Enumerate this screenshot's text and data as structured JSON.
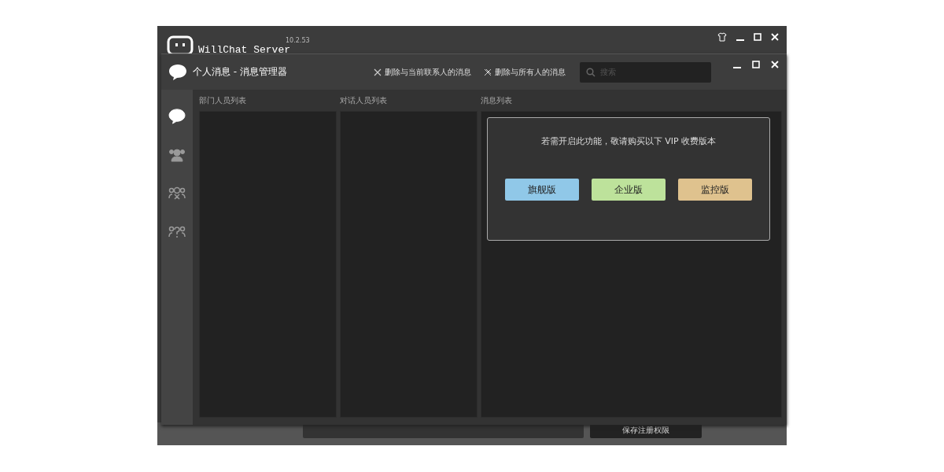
{
  "background_window": {
    "app_name": "WillChat Server",
    "version": "10.2.53",
    "save_button": "保存注册权限"
  },
  "window": {
    "title": "个人消息 - 消息管理器",
    "search": {
      "placeholder": "搜索"
    },
    "actions": [
      {
        "kind": "single",
        "label": "删除与当前联系人的消息"
      },
      {
        "kind": "all",
        "label": "删除与所有人的消息"
      }
    ]
  },
  "sidebar": {
    "items": [
      {
        "kind": "chat",
        "selected": true
      },
      {
        "kind": "group",
        "selected": false
      },
      {
        "kind": "group-remove",
        "selected": false
      },
      {
        "kind": "group-unknown",
        "selected": false
      }
    ]
  },
  "columns": [
    "部门人员列表",
    "对话人员列表",
    "消息列表"
  ],
  "vip_notice": {
    "message": "若需开启此功能，敬请购买以下 VIP 收费版本",
    "buttons": [
      {
        "label": "旗舰版",
        "color": "#90c8e8"
      },
      {
        "label": "企业版",
        "color": "#bde29b"
      },
      {
        "label": "监控版",
        "color": "#dfc28e"
      }
    ]
  }
}
